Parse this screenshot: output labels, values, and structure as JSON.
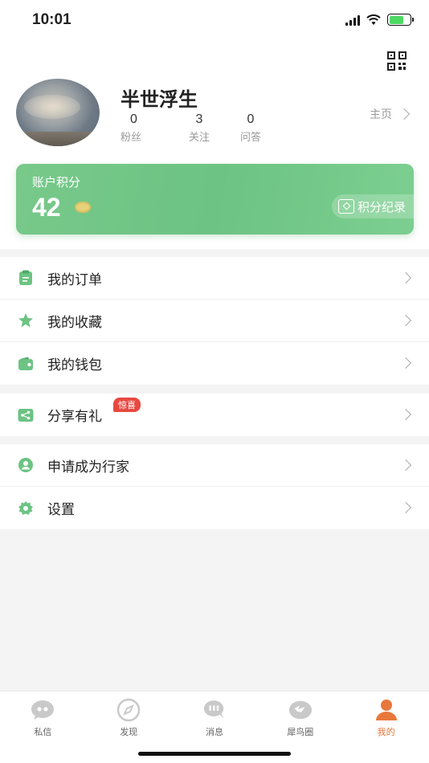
{
  "status_bar": {
    "time": "10:01",
    "battery_level": 0.7
  },
  "profile": {
    "username": "半世浮生",
    "stats": [
      {
        "value": "0",
        "label": "粉丝"
      },
      {
        "value": "3",
        "label": "关注"
      },
      {
        "value": "0",
        "label": "问答"
      }
    ],
    "homepage_label": "主页"
  },
  "points": {
    "title": "账户积分",
    "value": "42",
    "record_label": "积分纪录"
  },
  "menu_groups": [
    [
      {
        "label": "我的订单",
        "icon": "clipboard-icon"
      },
      {
        "label": "我的收藏",
        "icon": "star-icon"
      },
      {
        "label": "我的钱包",
        "icon": "wallet-icon"
      }
    ],
    [
      {
        "label": "分享有礼",
        "icon": "share-icon",
        "badge": "惊喜"
      }
    ],
    [
      {
        "label": "申请成为行家",
        "icon": "user-icon"
      },
      {
        "label": "设置",
        "icon": "gear-icon"
      }
    ]
  ],
  "tabs": [
    {
      "label": "私信",
      "icon": "chat-bubble-icon",
      "active": false
    },
    {
      "label": "发现",
      "icon": "compass-icon",
      "active": false
    },
    {
      "label": "消息",
      "icon": "message-icon",
      "active": false
    },
    {
      "label": "犀鸟圈",
      "icon": "bird-icon",
      "active": false
    },
    {
      "label": "我的",
      "icon": "person-icon",
      "active": true
    }
  ],
  "colors": {
    "accent_green": "#6cc383",
    "active_tab": "#e8783a",
    "badge_red": "#e8483f"
  }
}
